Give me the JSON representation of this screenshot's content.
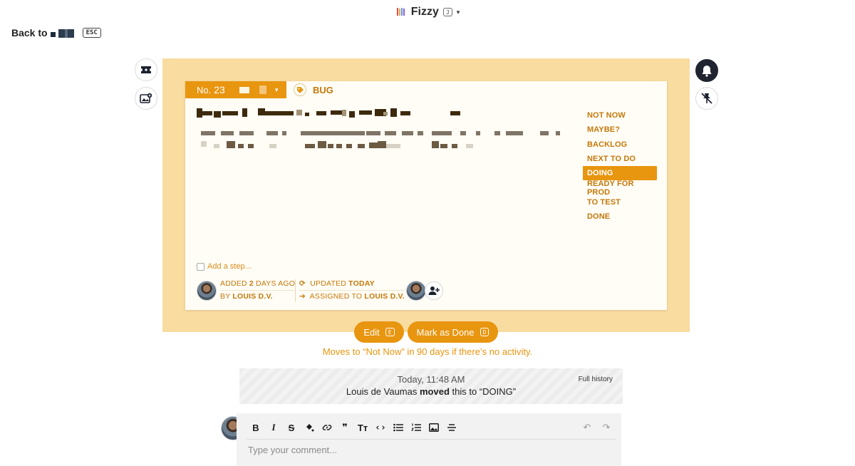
{
  "header": {
    "app_title": "Fizzy",
    "shortcut_key": "J",
    "back_label": "Back to",
    "back_shortcut": "ESC"
  },
  "card": {
    "number_label": "No.",
    "number": "23",
    "tag": "BUG",
    "add_step_label": "Add a step...",
    "added_prefix": "ADDED",
    "added_amount": "2",
    "added_suffix": "DAYS AGO",
    "added_by_prefix": "BY",
    "added_by": "LOUIS D.V.",
    "updated_prefix": "UPDATED",
    "updated_value": "TODAY",
    "assigned_prefix": "ASSIGNED TO",
    "assigned_to": "LOUIS D.V."
  },
  "statuses": [
    {
      "label": "NOT NOW",
      "active": false
    },
    {
      "label": "MAYBE?",
      "active": false
    },
    {
      "label": "BACKLOG",
      "active": false
    },
    {
      "label": "NEXT TO DO",
      "active": false
    },
    {
      "label": "DOING",
      "active": true
    },
    {
      "label": "READY FOR PROD",
      "active": false
    },
    {
      "label": "TO TEST",
      "active": false
    },
    {
      "label": "DONE",
      "active": false
    }
  ],
  "actions": {
    "edit_label": "Edit",
    "edit_shortcut": "E",
    "done_label": "Mark as Done",
    "done_shortcut": "D",
    "hint": "Moves to “Not Now” in 90 days if there’s no activity."
  },
  "history": {
    "time": "Today, 11:48 AM",
    "actor": "Louis de Vaumas",
    "verb": "moved",
    "rest": "this to “DOING”",
    "full_history_label": "Full history"
  },
  "composer": {
    "placeholder": "Type your comment..."
  },
  "colors": {
    "accent": "#e8950f",
    "accent_text": "#c4780b",
    "card_background": "#f8dca0"
  }
}
